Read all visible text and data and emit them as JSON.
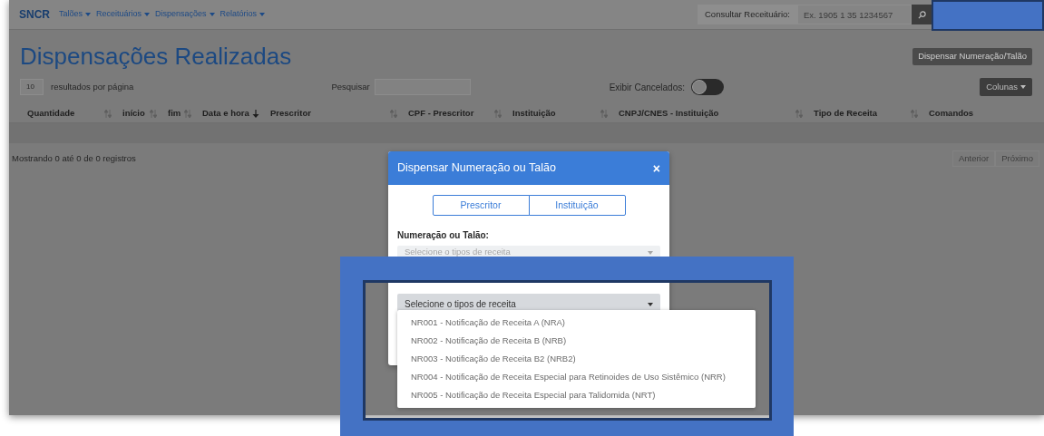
{
  "navbar": {
    "brand": "SNCR",
    "menus": [
      "Talões",
      "Receituários",
      "Dispensações",
      "Relatórios"
    ],
    "lookup": {
      "label": "Consultar Receituário:",
      "placeholder": "Ex. 1905 1 35 1234567"
    }
  },
  "page": {
    "title": "Dispensações Realizadas",
    "action_button": "Dispensar Numeração/Talão"
  },
  "controls": {
    "page_size": "10",
    "page_size_label": "resultados por página",
    "search_label": "Pesquisar",
    "show_cancelled": {
      "label": "Exibir Cancelados:",
      "on": false
    },
    "columns_button": "Colunas"
  },
  "table": {
    "columns": [
      {
        "label": "Quantidade",
        "sortable": true,
        "sorted": false
      },
      {
        "label": "início",
        "sortable": true,
        "sorted": false
      },
      {
        "label": "fim",
        "sortable": true,
        "sorted": false
      },
      {
        "label": "Data e hora",
        "sortable": true,
        "sorted": true
      },
      {
        "label": "Prescritor",
        "sortable": true,
        "sorted": false
      },
      {
        "label": "CPF - Prescritor",
        "sortable": true,
        "sorted": false
      },
      {
        "label": "Instituição",
        "sortable": true,
        "sorted": false
      },
      {
        "label": "CNPJ/CNES - Instituição",
        "sortable": true,
        "sorted": false
      },
      {
        "label": "Tipo de Receita",
        "sortable": true,
        "sorted": false
      },
      {
        "label": "Comandos",
        "sortable": false
      }
    ],
    "footer": "Mostrando 0 até 0 de 0 registros",
    "pager": [
      "Anterior",
      "Próximo"
    ]
  },
  "modal": {
    "title": "Dispensar Numeração ou Talão",
    "close": "×",
    "tabs": [
      {
        "label": "Prescritor",
        "selected": false
      },
      {
        "label": "Instituição",
        "selected": false
      }
    ],
    "fields": [
      {
        "label": "Numeração ou Talão:",
        "placeholder": "Selecione o tipos de receita",
        "disabled": true
      },
      {
        "value": "Selecione o tipos de receita",
        "disabled": false
      }
    ],
    "options": [
      "NR001 - Notificação de Receita A (NRA)",
      "NR002 - Notificação de Receita B (NRB)",
      "NR003 - Notificação de Receita B2 (NRB2)",
      "NR004 - Notificação de Receita Especial para Retinoides de Uso Sistêmico (NRR)",
      "NR005 - Notificação de Receita Especial para Talidomida (NRT)"
    ]
  }
}
